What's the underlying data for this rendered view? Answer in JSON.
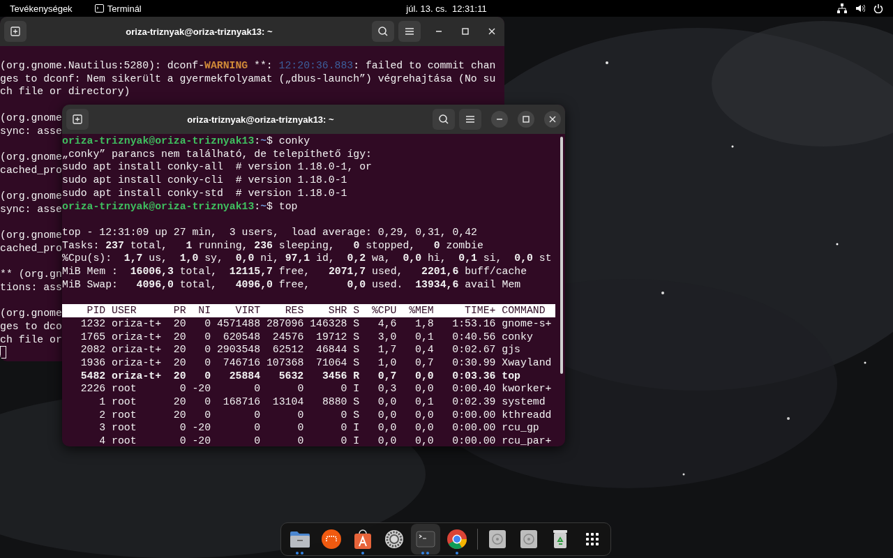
{
  "top_bar": {
    "activities": "Tevékenységek",
    "app": {
      "label": "Terminál"
    },
    "clock": "júl. 13. cs.  12:31:11"
  },
  "windows": [
    {
      "title": "oriza-triznyak@oriza-triznyak13: ~",
      "focused": false,
      "cursor_visible": true,
      "blocks": [
        [
          {
            "segments": [
              {
                "kind": "plain",
                "text": "(org.gnome.Nautilus:5280): dconf-"
              },
              {
                "kind": "warning",
                "text": "WARNING"
              },
              {
                "kind": "plain",
                "text": " **: "
              },
              {
                "kind": "time",
                "text": "12:20:36.883"
              },
              {
                "kind": "plain",
                "text": ": failed to commit chan"
              }
            ]
          },
          "ges to dconf: Nem sikerült a gyermekfolyamat („dbus-launch”) végrehajtása (No su",
          "ch file or directory)"
        ],
        [
          "(org.gnome",
          "sync: asse"
        ],
        [
          "(org.gnome",
          "cached_pro"
        ],
        [
          "(org.gnome",
          "sync: asse"
        ],
        [
          "(org.gnome",
          "cached_pro"
        ],
        [
          "** (org.gn",
          "tions: ass"
        ],
        [
          "(org.gnome",
          "ges to dco",
          "ch file or"
        ]
      ]
    },
    {
      "title": "oriza-triznyak@oriza-triznyak13: ~",
      "focused": true,
      "cursor_visible": false,
      "blocks": [
        [
          {
            "segments": [
              {
                "kind": "user",
                "text": "oriza-triznyak@oriza-triznyak13"
              },
              {
                "kind": "plain",
                "text": ":"
              },
              {
                "kind": "path",
                "text": "~"
              },
              {
                "kind": "plain",
                "text": "$ conky"
              }
            ]
          },
          "„conky” parancs nem található, de telepíthető így:",
          "sudo apt install conky-all  # version 1.18.0-1, or",
          "sudo apt install conky-cli  # version 1.18.0-1",
          "sudo apt install conky-std  # version 1.18.0-1",
          {
            "segments": [
              {
                "kind": "user",
                "text": "oriza-triznyak@oriza-triznyak13"
              },
              {
                "kind": "plain",
                "text": ":"
              },
              {
                "kind": "path",
                "text": "~"
              },
              {
                "kind": "plain",
                "text": "$ top"
              }
            ]
          }
        ],
        [
          "top - 12:31:09 up 27 min,  3 users,  load average: 0,29, 0,31, 0,42",
          "Tasks: **237** total,   **1** running, **236** sleeping,   **0** stopped,   **0** zombie",
          "%Cpu(s):  **1,7** us,  **1,0** sy,  **0,0** ni, **97,1** id,  **0,2** wa,  **0,0** hi,  **0,1** si,  **0,0** st",
          "MiB Mem :  **16006,3** total,  **12115,7** free,   **2071,7** used,   **2201,6** buff/cache",
          "MiB Swap:   **4096,0** total,   **4096,0** free,      **0,0** used.  **13934,6** avail Mem"
        ]
      ],
      "table": {
        "columns": [
          "PID",
          "USER",
          "PR",
          "NI",
          "VIRT",
          "RES",
          "SHR",
          "S",
          "%CPU",
          "%MEM",
          "TIME+",
          "COMMAND"
        ],
        "rows": [
          {
            "emphasized": false,
            "cells": [
              "1232",
              "oriza-t+",
              "20",
              "0",
              "4571488",
              "287096",
              "146328",
              "S",
              "4,6",
              "1,8",
              "1:53.16",
              "gnome-s+"
            ]
          },
          {
            "emphasized": false,
            "cells": [
              "1765",
              "oriza-t+",
              "20",
              "0",
              "620548",
              "24576",
              "19712",
              "S",
              "3,0",
              "0,1",
              "0:40.56",
              "conky"
            ]
          },
          {
            "emphasized": false,
            "cells": [
              "2082",
              "oriza-t+",
              "20",
              "0",
              "2903548",
              "62512",
              "46844",
              "S",
              "1,7",
              "0,4",
              "0:02.67",
              "gjs"
            ]
          },
          {
            "emphasized": false,
            "cells": [
              "1936",
              "oriza-t+",
              "20",
              "0",
              "746716",
              "107368",
              "71064",
              "S",
              "1,0",
              "0,7",
              "0:30.99",
              "Xwayland"
            ]
          },
          {
            "emphasized": true,
            "cells": [
              "5482",
              "oriza-t+",
              "20",
              "0",
              "25884",
              "5632",
              "3456",
              "R",
              "0,7",
              "0,0",
              "0:03.36",
              "top"
            ]
          },
          {
            "emphasized": false,
            "cells": [
              "2226",
              "root",
              "0",
              "-20",
              "0",
              "0",
              "0",
              "I",
              "0,3",
              "0,0",
              "0:00.40",
              "kworker+"
            ]
          },
          {
            "emphasized": false,
            "cells": [
              "1",
              "root",
              "20",
              "0",
              "168716",
              "13104",
              "8880",
              "S",
              "0,0",
              "0,1",
              "0:02.39",
              "systemd"
            ]
          },
          {
            "emphasized": false,
            "cells": [
              "2",
              "root",
              "20",
              "0",
              "0",
              "0",
              "0",
              "S",
              "0,0",
              "0,0",
              "0:00.00",
              "kthreadd"
            ]
          },
          {
            "emphasized": false,
            "cells": [
              "3",
              "root",
              "0",
              "-20",
              "0",
              "0",
              "0",
              "I",
              "0,0",
              "0,0",
              "0:00.00",
              "rcu_gp"
            ]
          },
          {
            "emphasized": false,
            "cells": [
              "4",
              "root",
              "0",
              "-20",
              "0",
              "0",
              "0",
              "I",
              "0,0",
              "0,0",
              "0:00.00",
              "rcu_par+"
            ]
          }
        ]
      }
    }
  ],
  "dock": {
    "pinned": [
      {
        "kind": "files",
        "running": true,
        "multiple": true,
        "selected": false
      },
      {
        "kind": "orange-app",
        "running": false,
        "selected": false
      },
      {
        "kind": "app-center",
        "running": true,
        "multiple": false,
        "selected": false
      },
      {
        "kind": "settings",
        "running": false,
        "selected": false
      },
      {
        "kind": "terminal",
        "running": true,
        "multiple": true,
        "selected": true
      },
      {
        "kind": "browser",
        "running": true,
        "multiple": false,
        "selected": false
      }
    ],
    "devices": [
      {
        "kind": "disk",
        "running": false,
        "selected": false
      },
      {
        "kind": "disk",
        "running": false,
        "selected": false
      },
      {
        "kind": "trash",
        "running": false,
        "selected": false
      },
      {
        "kind": "app-grid",
        "running": false,
        "selected": false
      }
    ]
  }
}
